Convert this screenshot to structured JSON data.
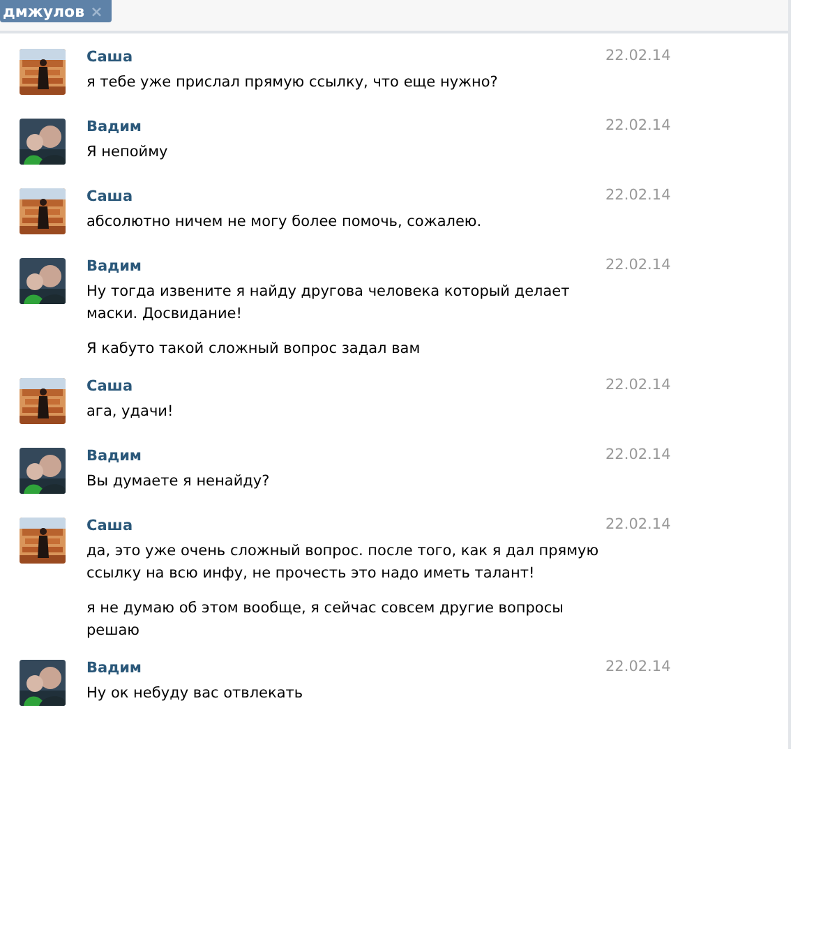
{
  "header": {
    "tag": {
      "label": "дмжулов",
      "close": "×"
    }
  },
  "messages": [
    {
      "sender": "Саша",
      "avatar": {
        "kind": "picture"
      },
      "date": "22.02.14",
      "texts": [
        "я тебе уже прислал прямую ссылку, что еще нужно?"
      ]
    },
    {
      "sender": "Вадим",
      "avatar": {
        "kind": "picture"
      },
      "date": "22.02.14",
      "texts": [
        "Я непойму"
      ]
    },
    {
      "sender": "Саша",
      "avatar": {
        "kind": "picture"
      },
      "date": "22.02.14",
      "texts": [
        "абсолютно ничем не могу более помочь, сожалею."
      ]
    },
    {
      "sender": "Вадим",
      "avatar": {
        "kind": "picture"
      },
      "date": "22.02.14",
      "texts": [
        "Ну тогда извените я найду другова человека который делает маски. Досвидание!",
        "Я кабуто такой сложный вопрос задал вам"
      ]
    },
    {
      "sender": "Саша",
      "avatar": {
        "kind": "picture"
      },
      "date": "22.02.14",
      "texts": [
        "ага, удачи!"
      ]
    },
    {
      "sender": "Вадим",
      "avatar": {
        "kind": "picture"
      },
      "date": "22.02.14",
      "texts": [
        "Вы думаете я ненайду?"
      ]
    },
    {
      "sender": "Саша",
      "avatar": {
        "kind": "picture"
      },
      "date": "22.02.14",
      "texts": [
        "да, это уже очень сложный вопрос. после того, как я дал прямую ссылку на всю инфу, не прочесть это надо иметь талант!",
        "я не думаю об этом вообще, я сейчас совсем другие вопросы решаю"
      ]
    },
    {
      "sender": "Вадим",
      "avatar": {
        "kind": "picture"
      },
      "date": "22.02.14",
      "texts": [
        "Ну ок небуду вас отвлекать"
      ]
    }
  ]
}
